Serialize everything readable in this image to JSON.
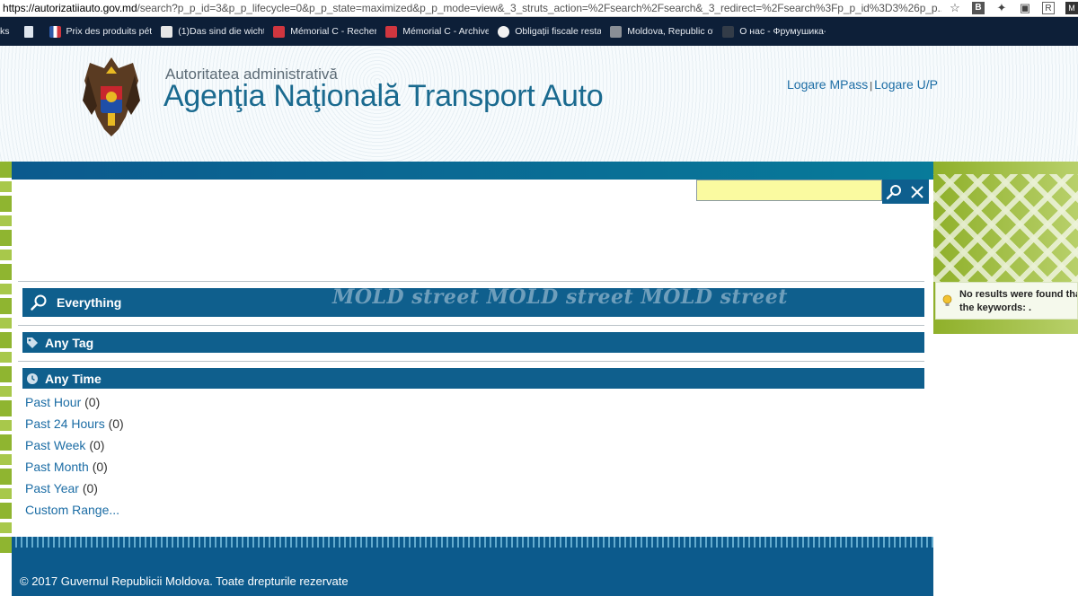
{
  "browser": {
    "url_host": "https://autorizatiiauto.gov.md",
    "url_rest": "/search?p_p_id=3&p_p_lifecycle=0&p_p_state=maximized&p_p_mode=view&_3_struts_action=%2Fsearch%2Fsearch&_3_redirect=%2Fsearch%3Fp_p_id%3D3%26p_p...",
    "bookmarks": [
      {
        "label": "ks",
        "icon": "none",
        "color": "#0d1f38"
      },
      {
        "label": "",
        "icon": "page-icon",
        "color": "#dfe6ee"
      },
      {
        "label": "Prix des produits pét",
        "icon": "flag-icon",
        "color": "#2f5aa8"
      },
      {
        "label": "(1)Das sind die wichti",
        "icon": "mail-icon",
        "color": "#e6e6e6"
      },
      {
        "label": "Mémorial C - Recherc",
        "icon": "red-lion-icon",
        "color": "#d0363f"
      },
      {
        "label": "Mémorial C - Archive",
        "icon": "red-lion-icon",
        "color": "#d0363f"
      },
      {
        "label": "Obligații fiscale resta",
        "icon": "spark-icon",
        "color": "#f2f2f2"
      },
      {
        "label": "Moldova, Republic of",
        "icon": "m-logo-icon",
        "color": "#8a8f96"
      },
      {
        "label": "О нас - Фрумушика-",
        "icon": "dark-leaf-icon",
        "color": "#333c48"
      }
    ]
  },
  "header": {
    "subtitle": "Autoritatea administrativă",
    "title": "Agenţia Naţională Transport Auto",
    "login_mpass": "Logare MPass",
    "login_separator": "|",
    "login_up": "Logare U/P"
  },
  "search": {
    "value": "",
    "search_icon": "magnifier-icon",
    "clear_icon": "x-icon"
  },
  "facets": {
    "everything_label": "Everything",
    "tag_label": "Any Tag",
    "time_label": "Any Time",
    "time_options": [
      {
        "label": "Past Hour",
        "count": "(0)"
      },
      {
        "label": "Past 24 Hours",
        "count": "(0)"
      },
      {
        "label": "Past Week",
        "count": "(0)"
      },
      {
        "label": "Past Month",
        "count": "(0)"
      },
      {
        "label": "Past Year",
        "count": "(0)"
      },
      {
        "label": "Custom Range...",
        "count": ""
      }
    ]
  },
  "notice": {
    "line1": "No results were found tha",
    "line2": "the keywords: ."
  },
  "watermark": "MOLD street MOLD street MOLD street",
  "footer": {
    "copyright": "© 2017 Guvernul Republicii Moldova. Toate drepturile rezervate"
  },
  "colors": {
    "primary_blue": "#0f5f8d",
    "link_blue": "#1c6da5",
    "accent_green": "#8fb530",
    "search_yellow": "#fafaa0"
  }
}
